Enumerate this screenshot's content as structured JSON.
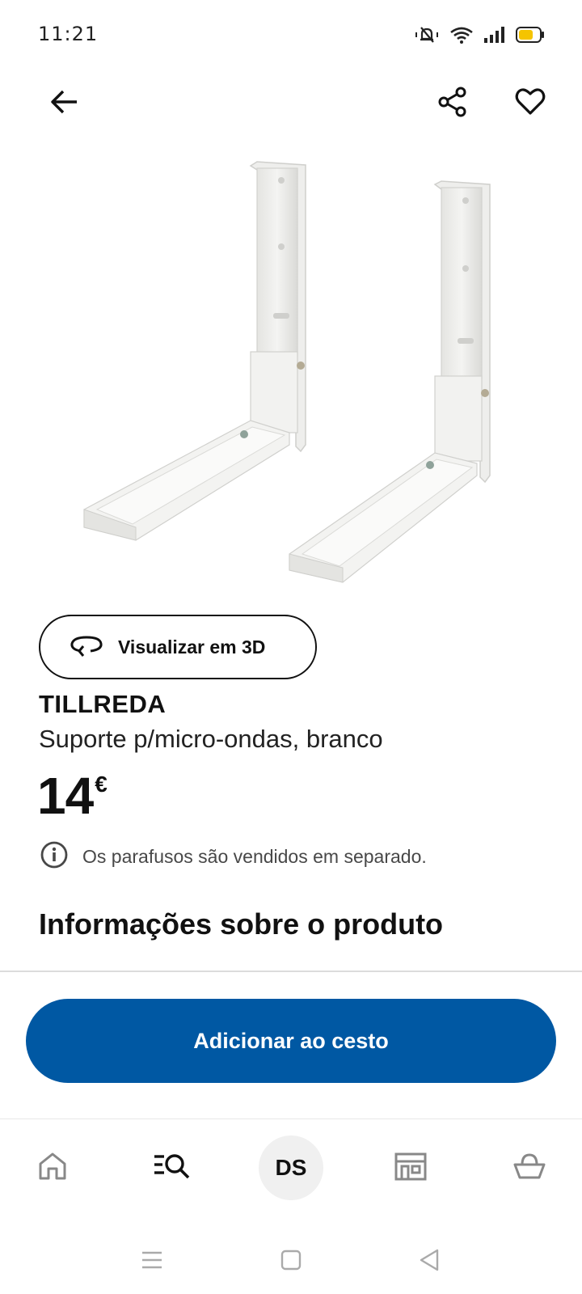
{
  "status_bar": {
    "time": "11:21",
    "icons": [
      "mute-icon",
      "wifi-icon",
      "signal-icon",
      "battery-icon"
    ],
    "battery_color": "#f5c400"
  },
  "top_bar": {
    "icons": [
      "back-arrow-icon",
      "share-icon",
      "heart-icon"
    ]
  },
  "view_3d": {
    "label": "Visualizar em 3D"
  },
  "product": {
    "name": "TILLREDA",
    "description": "Suporte p/micro-ondas, branco",
    "price": "14",
    "currency": "€",
    "note": "Os parafusos são vendidos em separado."
  },
  "section": {
    "title": "Informações sobre o produto"
  },
  "cart_button": {
    "label": "Adicionar ao cesto",
    "color": "#0058a3"
  },
  "bottom_nav": {
    "items": [
      "home-icon",
      "search-list-icon",
      "profile",
      "store-icon",
      "basket-icon"
    ],
    "avatar_initials": "DS"
  },
  "system_nav": [
    "menu-icon",
    "square-icon",
    "back-triangle-icon"
  ]
}
